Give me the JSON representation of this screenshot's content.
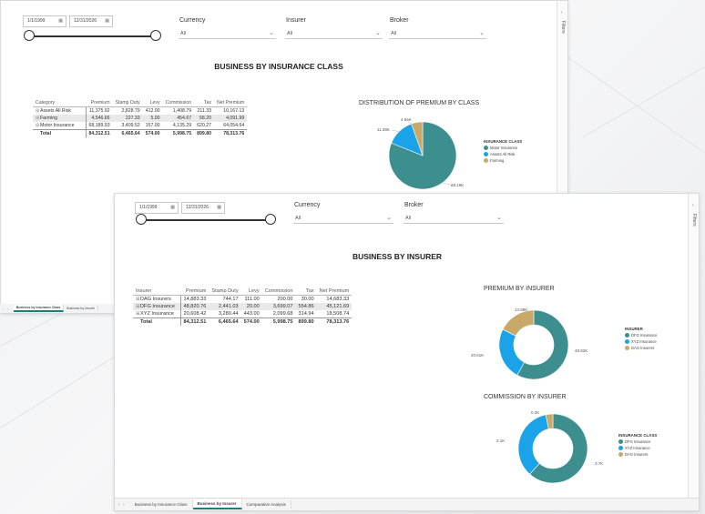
{
  "window1": {
    "date_start": "1/1/1999",
    "date_end": "12/31/2026",
    "filters": [
      {
        "label": "Currency",
        "value": "All"
      },
      {
        "label": "Insurer",
        "value": "All"
      },
      {
        "label": "Broker",
        "value": "All"
      }
    ],
    "title": "BUSINESS BY INSURANCE CLASS",
    "table": {
      "headers": [
        "Category",
        "Premium",
        "Stamp Duty",
        "Levy",
        "Commission",
        "Tax",
        "Net Premium"
      ],
      "rows": [
        [
          "Assets All Risk",
          "11,375.92",
          "2,828.79",
          "412.00",
          "1,408.79",
          "211.33",
          "10,167.13"
        ],
        [
          "Farming",
          "4,546.66",
          "227.33",
          "5.00",
          "454.67",
          "68.20",
          "4,091.99"
        ],
        [
          "Motor Insurance",
          "68,189.93",
          "3,409.52",
          "157.00",
          "4,135.29",
          "620.27",
          "64,054.64"
        ]
      ],
      "total": [
        "Total",
        "84,312.51",
        "6,465.64",
        "574.00",
        "5,998.75",
        "899.80",
        "78,313.76"
      ]
    },
    "chart_title": "DISTRIBUTION OF PREMIUM BY CLASS",
    "chart_labels": [
      "4.55K",
      "11.38K",
      "68.19K"
    ],
    "legend": {
      "title": "INSURANCE CLASS",
      "items": [
        "Motor Insurance",
        "Assets All Risk",
        "Farming"
      ]
    },
    "filters_label": "Filters",
    "tabs": [
      "Business by Insurance Class",
      "Business by Insurer"
    ]
  },
  "window2": {
    "date_start": "1/1/1999",
    "date_end": "12/31/2026",
    "filters": [
      {
        "label": "Currency",
        "value": "All"
      },
      {
        "label": "Broker",
        "value": "All"
      }
    ],
    "title": "BUSINESS BY INSURER",
    "table": {
      "headers": [
        "Insurer",
        "Premium",
        "Stamp Duty",
        "Levy",
        "Commission",
        "Tax",
        "Net Premium"
      ],
      "rows": [
        [
          "DAG Insurers",
          "14,883.33",
          "744.17",
          "111.00",
          "200.00",
          "30.00",
          "14,683.33"
        ],
        [
          "DFG Insurance",
          "48,820.76",
          "2,441.03",
          "20.00",
          "3,699.07",
          "554.86",
          "45,121.69"
        ],
        [
          "XYZ Insurance",
          "20,608.42",
          "3,280.44",
          "443.00",
          "2,099.68",
          "314.94",
          "18,508.74"
        ]
      ],
      "total": [
        "Total",
        "84,312.51",
        "6,465.64",
        "574.00",
        "5,998.75",
        "899.80",
        "78,313.76"
      ]
    },
    "premium_title": "PREMIUM BY INSURER",
    "premium_labels": [
      "14.88K",
      "20.61K",
      "48.82K"
    ],
    "premium_legend": {
      "title": "INSURER",
      "items": [
        "DFG Insurance",
        "XYZ Insurance",
        "DAG Insurers"
      ]
    },
    "commission_title": "COMMISSION BY INSURER",
    "commission_labels": [
      "0.2K",
      "2.1K",
      "3.7K"
    ],
    "commission_legend": {
      "title": "INSURANCE CLASS",
      "items": [
        "DFG Insurance",
        "XYZ Insurance",
        "DAG Insurers"
      ]
    },
    "filters_label": "Filters",
    "tabs": [
      "Business by Insurance Class",
      "Business by Insurer",
      "Comparative Analysis"
    ]
  },
  "colors": {
    "teal": "#3d8f8f",
    "blue": "#1aa3e8",
    "tan": "#c8a96a"
  },
  "chart_data": [
    {
      "type": "pie",
      "title": "DISTRIBUTION OF PREMIUM BY CLASS",
      "categories": [
        "Motor Insurance",
        "Assets All Risk",
        "Farming"
      ],
      "values": [
        68.19,
        11.38,
        4.55
      ],
      "unit": "K"
    },
    {
      "type": "pie",
      "title": "PREMIUM BY INSURER",
      "categories": [
        "DFG Insurance",
        "XYZ Insurance",
        "DAG Insurers"
      ],
      "values": [
        48.82,
        20.61,
        14.88
      ],
      "unit": "K"
    },
    {
      "type": "pie",
      "title": "COMMISSION BY INSURER",
      "categories": [
        "DFG Insurance",
        "XYZ Insurance",
        "DAG Insurers"
      ],
      "values": [
        3.7,
        2.1,
        0.2
      ],
      "unit": "K"
    }
  ]
}
